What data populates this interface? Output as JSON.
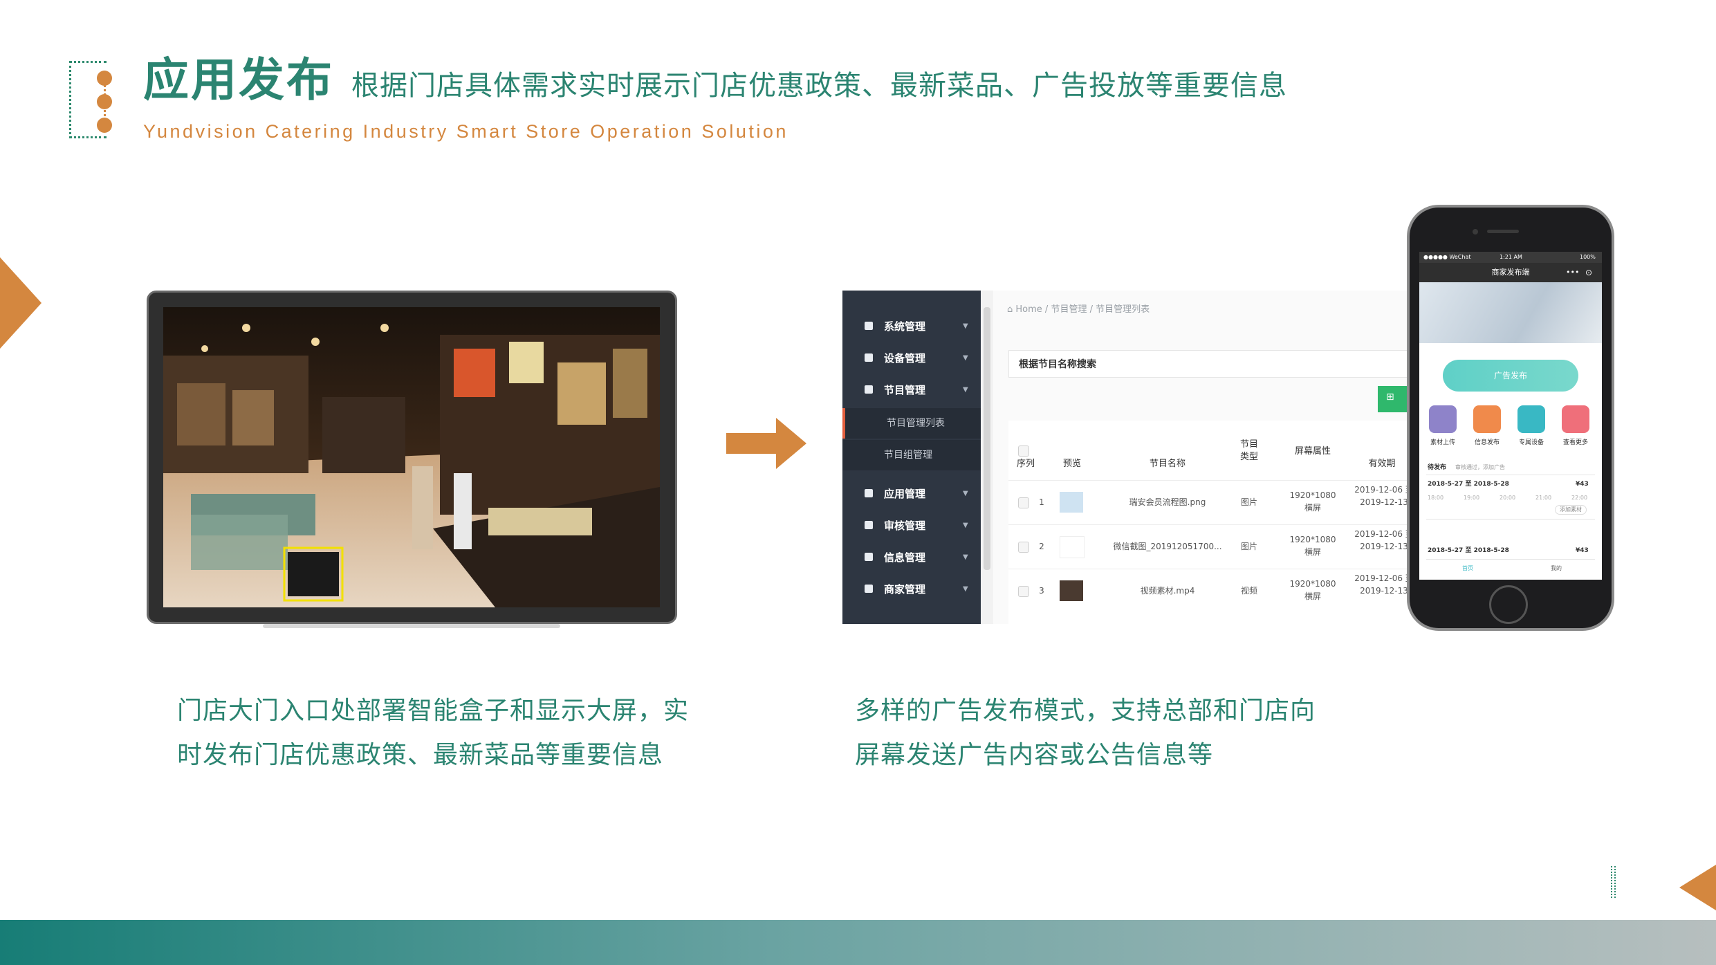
{
  "header": {
    "title": "应用发布",
    "subtitle": "根据门店具体需求实时展示门店优惠政策、最新菜品、广告投放等重要信息",
    "english_subtitle": "Yundvision Catering Industry Smart Store Operation Solution"
  },
  "admin_ui": {
    "sidebar": [
      {
        "label": "系统管理"
      },
      {
        "label": "设备管理"
      },
      {
        "label": "节目管理"
      },
      {
        "label": "节目管理列表",
        "sub": true
      },
      {
        "label": "节目组管理",
        "sub": true
      },
      {
        "label": "应用管理"
      },
      {
        "label": "审核管理"
      },
      {
        "label": "信息管理"
      },
      {
        "label": "商家管理"
      }
    ],
    "breadcrumb": [
      "Home",
      "节目管理",
      "节目管理列表"
    ],
    "search_placeholder": "根据节目名称搜索",
    "table": {
      "headers": [
        "序列",
        "预览",
        "节目名称",
        "节目类型",
        "屏幕属性",
        "有效期"
      ],
      "rows": [
        {
          "index": "1",
          "name": "瑞安会员流程图.png",
          "type": "图片",
          "screen": "1920*1080 横屏",
          "validity": "2019-12-06 至 2019-12-13"
        },
        {
          "index": "2",
          "name": "微信截图_201912051700...",
          "type": "图片",
          "screen": "1920*1080 横屏",
          "validity": "2019-12-06 至 2019-12-13"
        },
        {
          "index": "3",
          "name": "视频素材.mp4",
          "type": "视频",
          "screen": "1920*1080 横屏",
          "validity": "2019-12-06 至 2019-12-13"
        }
      ]
    }
  },
  "phone_ui": {
    "status_carrier": "●●●●● WeChat",
    "status_time": "1:21 AM",
    "status_battery": "100%",
    "nav_title": "商家发布端",
    "ad_button": "广告发布",
    "icons": [
      {
        "label": "素材上传",
        "color": "#8e83c9"
      },
      {
        "label": "信息发布",
        "color": "#f08a4b"
      },
      {
        "label": "专属设备",
        "color": "#39b8c4"
      },
      {
        "label": "查看更多",
        "color": "#ef6f7a"
      }
    ],
    "pending_label": "待发布",
    "pending_hint": "审核通过，添加广告",
    "entry1_dates": "2018-5-27  至  2018-5-28",
    "entry1_price": "¥43",
    "entry1_times": [
      "18:00",
      "19:00",
      "20:00",
      "21:00",
      "22:00"
    ],
    "entry1_action": "添加素材",
    "entry2_dates": "2018-5-27  至  2018-5-28",
    "entry2_price": "¥43",
    "tab_home": "首页",
    "tab_me": "我的"
  },
  "captions": {
    "left_line1": "门店大门入口处部署智能盒子和显示大屏，实",
    "left_line2": "时发布门店优惠政策、最新菜品等重要信息",
    "right_line1": "多样的广告发布模式，支持总部和门店向",
    "right_line2": "屏幕发送广告内容或公告信息等"
  },
  "colors": {
    "accent_green": "#2b8471",
    "accent_orange": "#d4873f"
  }
}
